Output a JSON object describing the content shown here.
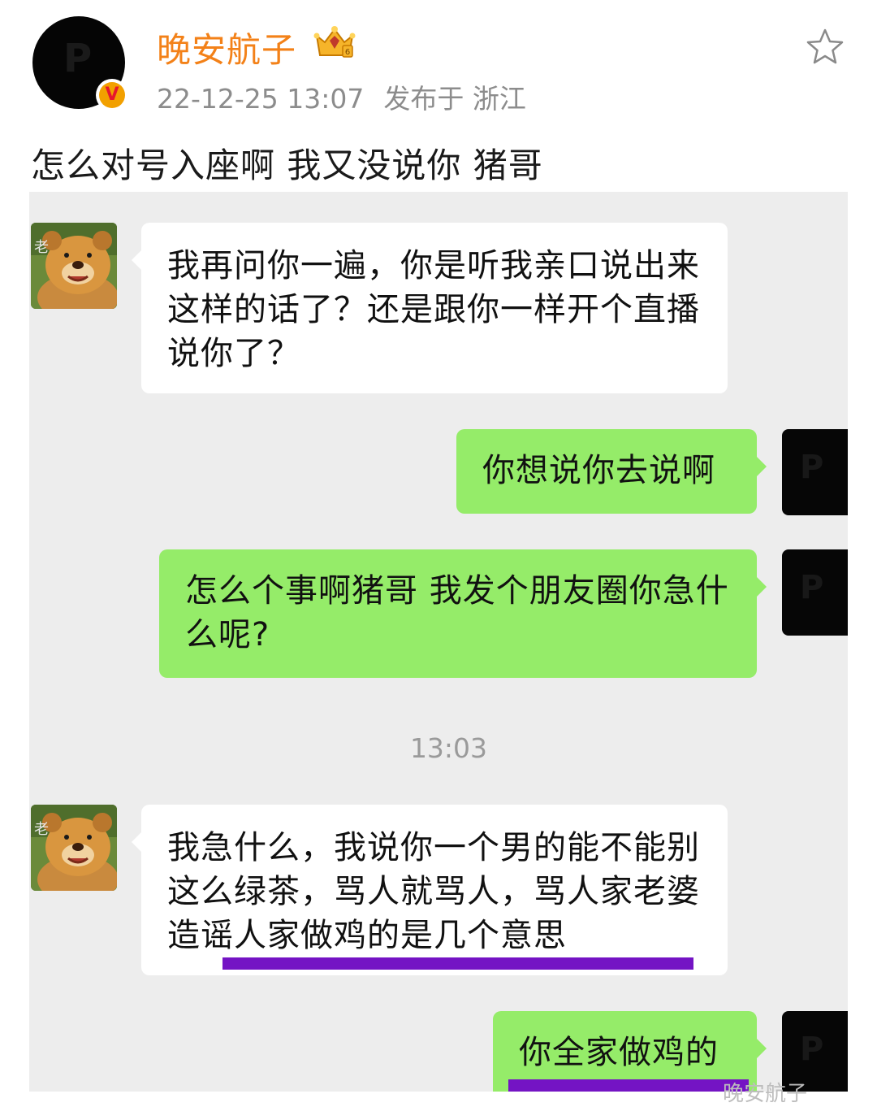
{
  "post": {
    "author": "晚安航子",
    "timestamp": "22-12-25 13:07",
    "location": "发布于 浙江",
    "text": "怎么对号入座啊 我又没说你 猪哥",
    "badge_icon": "crown-level-icon",
    "verify_icon": "verified-v-icon",
    "favorite_icon": "star-icon",
    "avatar_letter": "P"
  },
  "chat": {
    "messages": [
      {
        "side": "left",
        "text": "我再问你一遍，你是听我亲口说出来这样的话了？还是跟你一样开个直播说你了？"
      },
      {
        "side": "right",
        "text": "你想说你去说啊"
      },
      {
        "side": "right",
        "text": "怎么个事啊猪哥 我发个朋友圈你急什么呢?"
      },
      {
        "side": "left",
        "text": "我急什么，我说你一个男的能不能别这么绿茶，骂人就骂人，骂人家老婆造谣人家做鸡的是几个意思"
      },
      {
        "side": "right",
        "text": "你全家做鸡的"
      }
    ],
    "time_divider": "13:03",
    "bear_glyph": "老",
    "watermark": "晚安航子"
  },
  "colors": {
    "author_name": "#f38118",
    "green_bubble": "#95ec69",
    "chat_bg": "#ededed",
    "underline": "#7414c4"
  }
}
